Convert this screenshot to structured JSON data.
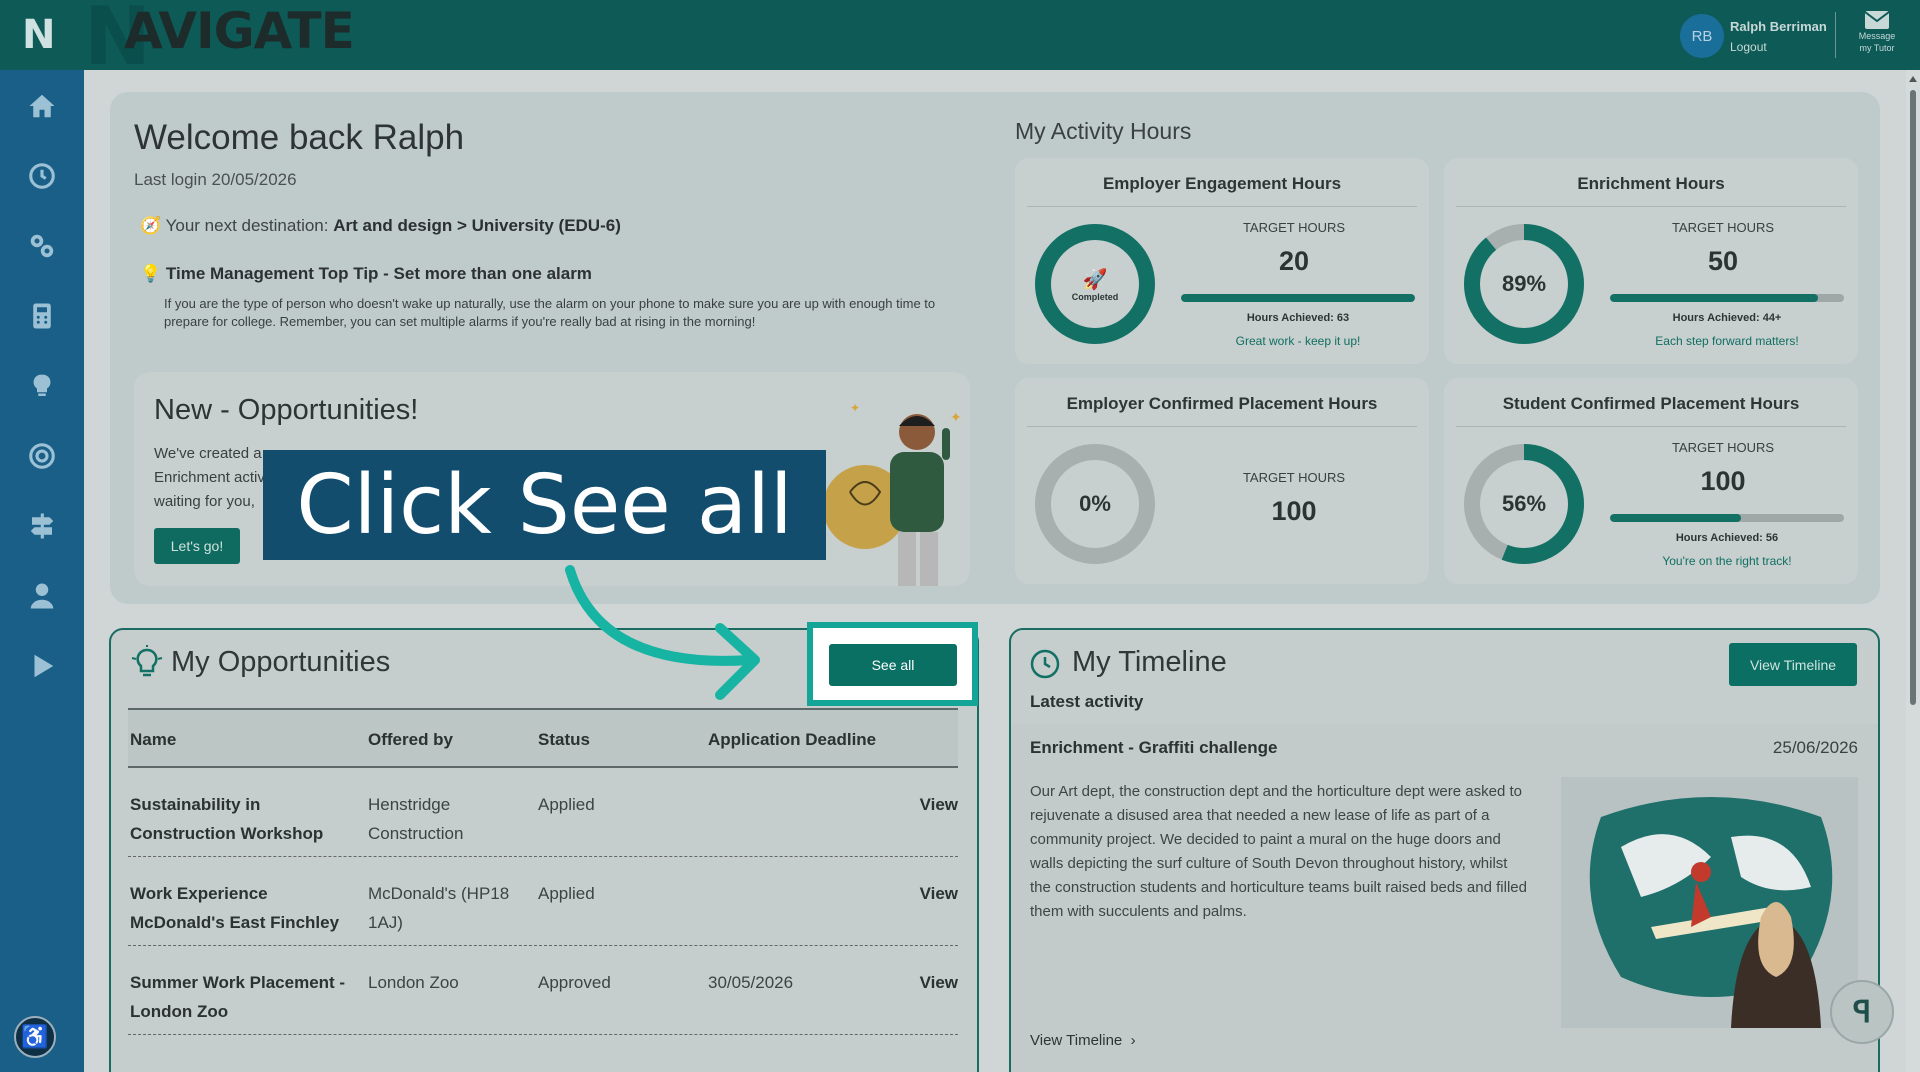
{
  "header": {
    "logo_letter": "N",
    "brand_initial": "N",
    "brand_word": "AVIGATE",
    "user_initials": "RB",
    "user_name": "Ralph Berriman",
    "logout": "Logout",
    "message_line1": "Message",
    "message_line2": "my Tutor"
  },
  "sidebar": {
    "items": [
      "home-icon",
      "clock-icon",
      "gears-icon",
      "calculator-icon",
      "lightbulb-icon",
      "target-icon",
      "signpost-icon",
      "user-icon",
      "play-icon"
    ]
  },
  "welcome": {
    "title": "Welcome back Ralph",
    "last_login": "Last login 20/05/2026",
    "destination_label": "Your next destination:",
    "destination_value": "Art and design > University (EDU-6)",
    "tip_title": "Time Management Top Tip - Set more than one alarm",
    "tip_text": "If you are the type of person who doesn't wake up naturally, use the alarm on your phone to make sure you are up with enough time to prepare for college. Remember, you can set multiple alarms if you're really bad at rising in the morning!"
  },
  "new_opps": {
    "title": "New - Opportunities!",
    "text_line1": "We've created a",
    "text_line2": "Enrichment activ",
    "text_line3": "waiting for you,",
    "button": "Let's go!"
  },
  "activity": {
    "title": "My Activity Hours",
    "cards": [
      {
        "title": "Employer Engagement Hours",
        "target_label": "TARGET HOURS",
        "target": "20",
        "achieved": "Hours Achieved: 63",
        "message": "Great work - keep it up!",
        "center": "Completed",
        "progress": 1.0
      },
      {
        "title": "Enrichment Hours",
        "target_label": "TARGET HOURS",
        "target": "50",
        "achieved": "Hours Achieved: 44+",
        "message": "Each step forward matters!",
        "center": "89%",
        "progress": 0.89
      },
      {
        "title": "Employer Confirmed Placement Hours",
        "target_label": "TARGET HOURS",
        "target": "100",
        "achieved": "",
        "message": "",
        "center": "0%",
        "progress": 0
      },
      {
        "title": "Student Confirmed Placement Hours",
        "target_label": "TARGET HOURS",
        "target": "100",
        "achieved": "Hours Achieved: 56",
        "message": "You're on the right track!",
        "center": "56%",
        "progress": 0.56
      }
    ]
  },
  "opportunities": {
    "title": "My Opportunities",
    "see_all": "See all",
    "columns": [
      "Name",
      "Offered by",
      "Status",
      "Application Deadline"
    ],
    "rows": [
      {
        "name": "Sustainability in Construction Workshop",
        "offered_by": "Henstridge Construction",
        "status": "Applied",
        "deadline": "",
        "action": "View"
      },
      {
        "name": "Work Experience McDonald's East Finchley",
        "offered_by": "McDonald's (HP18 1AJ)",
        "status": "Applied",
        "deadline": "",
        "action": "View"
      },
      {
        "name": "Summer Work Placement - London Zoo",
        "offered_by": "London Zoo",
        "status": "Approved",
        "deadline": "30/05/2026",
        "action": "View"
      }
    ]
  },
  "timeline": {
    "title": "My Timeline",
    "view_button": "View Timeline",
    "latest": "Latest activity",
    "entry_title": "Enrichment - Graffiti challenge",
    "entry_date": "25/06/2026",
    "entry_text": "Our Art dept, the construction dept and the horticulture dept were asked to rejuvenate a disused area that needed a new lease of life as part of a community project. We decided to paint a mural on the huge doors and walls depicting the surf culture of South Devon throughout history, whilst the construction students and horticulture teams built raised beds and filled them with succulents and palms.",
    "link": "View Timeline"
  },
  "callout": {
    "text": "Click See all"
  },
  "colors": {
    "header": "#0d5a57",
    "sidebar": "#1a5f88",
    "accent": "#0b7064",
    "highlight": "#13a597",
    "callout": "#124d6e"
  }
}
